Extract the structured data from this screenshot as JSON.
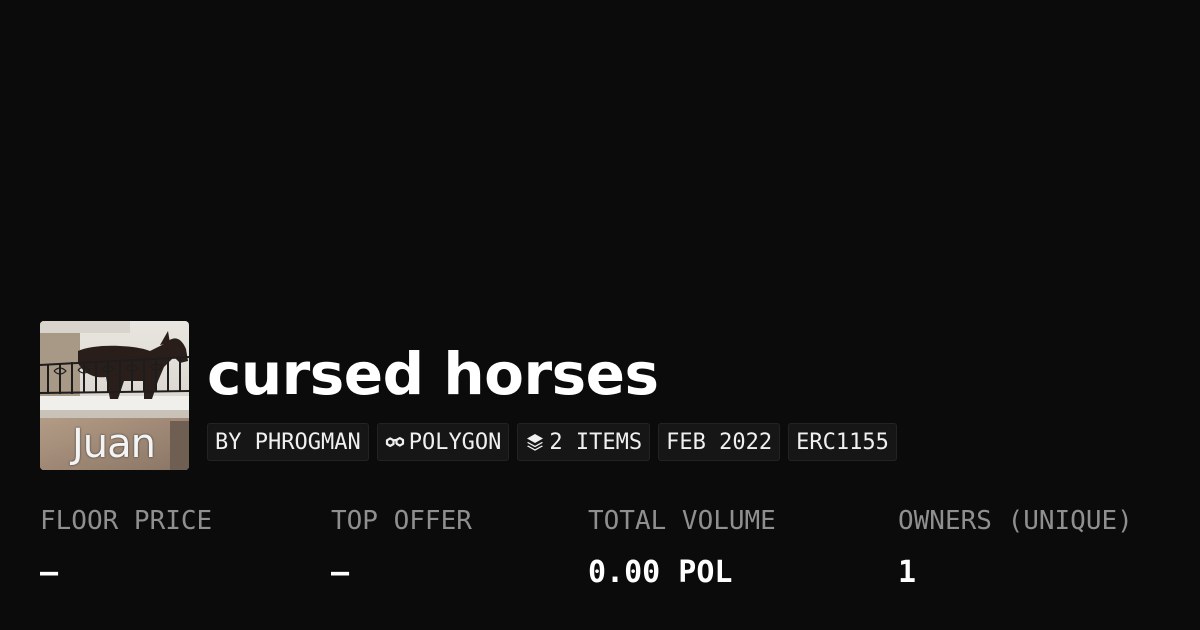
{
  "collection": {
    "name": "cursed horses",
    "image_caption": "Juan",
    "image_icon": "horse-on-balcony-image"
  },
  "tags": [
    {
      "label": "BY PHROGMAN",
      "icon": ""
    },
    {
      "label": "POLYGON",
      "icon": "polygon-link-icon"
    },
    {
      "label": "2 ITEMS",
      "icon": "layers-icon"
    },
    {
      "label": "FEB 2022",
      "icon": ""
    },
    {
      "label": "ERC1155",
      "icon": ""
    }
  ],
  "stats": [
    {
      "label": "FLOOR PRICE",
      "value": "–"
    },
    {
      "label": "TOP OFFER",
      "value": "–"
    },
    {
      "label": "TOTAL VOLUME",
      "value": "0.00 POL"
    },
    {
      "label": "OWNERS (UNIQUE)",
      "value": "1"
    }
  ],
  "colors": {
    "background": "#0b0b0b",
    "tag_background": "#161616",
    "label": "#8f8f8f",
    "text": "#ffffff"
  }
}
